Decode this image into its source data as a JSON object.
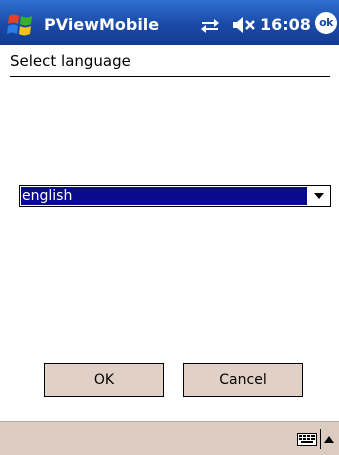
{
  "titlebar": {
    "app_title": "PViewMobile",
    "clock": "16:08",
    "ok_label": "ok"
  },
  "header": {
    "title": "Select language"
  },
  "language_select": {
    "selected": "english"
  },
  "buttons": {
    "ok_label": "OK",
    "cancel_label": "Cancel"
  },
  "colors": {
    "titlebar": "#1a4aa8",
    "selection": "#0a0a8c",
    "button_face": "#e0d0c6",
    "menubar": "#dccbc0"
  },
  "icons": {
    "start": "windows-flag-icon",
    "connectivity": "connectivity-icon",
    "volume": "speaker-muted-icon",
    "keyboard": "keyboard-icon"
  }
}
